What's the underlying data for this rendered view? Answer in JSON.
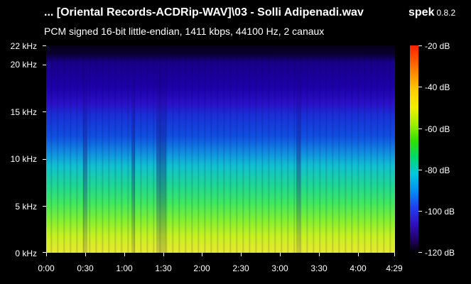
{
  "window": {
    "title": "... [Oriental Records-ACDRip-WAV]\\03 - Solli Adipenadi.wav",
    "app_name": "spek",
    "app_version": "0.8.2",
    "subtitle": "PCM signed 16-bit little-endian, 1411 kbps, 44100 Hz, 2 canaux"
  },
  "frequency_axis": {
    "labels": [
      "22 kHz",
      "20 kHz",
      "15 kHz",
      "10 kHz",
      "5 kHz",
      "0 kHz"
    ]
  },
  "time_axis": {
    "labels": [
      "0:00",
      "0:30",
      "1:00",
      "1:30",
      "2:00",
      "2:30",
      "3:00",
      "3:30",
      "4:00",
      "4:29"
    ]
  },
  "level_scale": {
    "labels": [
      "-20 dB",
      "-40 dB",
      "-60 dB",
      "-80 dB",
      "-100 dB",
      "-120 dB"
    ],
    "colors": [
      "#ff2000",
      "#ffd000",
      "#30e000",
      "#00c8e0",
      "#2040f0",
      "#200060"
    ]
  }
}
